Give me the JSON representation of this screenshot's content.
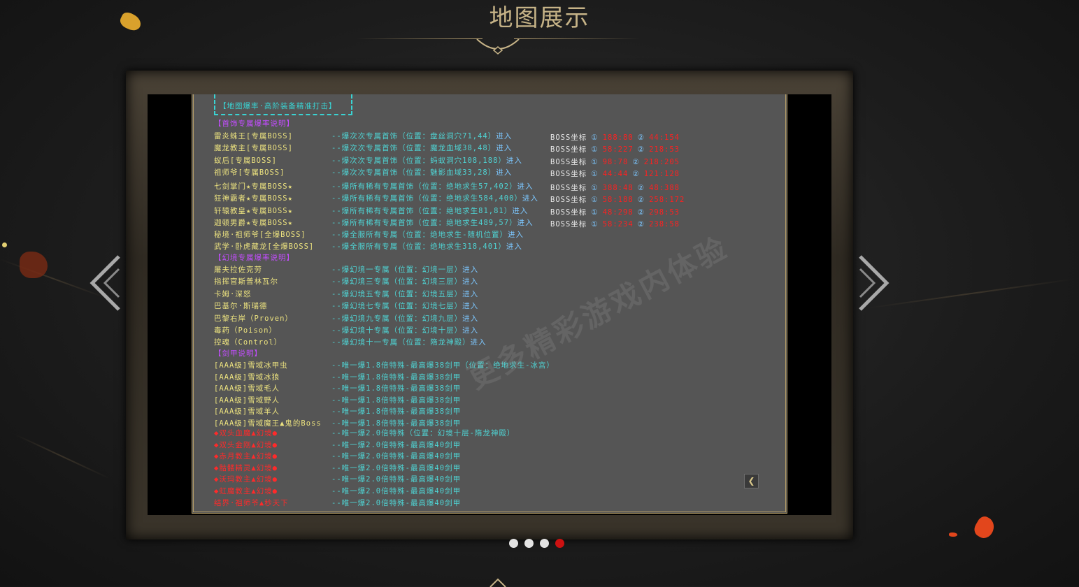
{
  "page": {
    "title": "地图展示",
    "watermark": "更多精彩游戏内体验"
  },
  "colors": {
    "title": "#c6b387",
    "gold_item": "#ece27f",
    "red_item": "#ff2a2a",
    "purple_header": "#c34dff",
    "cyan_desc": "#4fd3d3",
    "link_blue": "#7cc7ff",
    "active_dot": "#cc1111",
    "panel_bg": "#555555"
  },
  "icons": {
    "prev": "chevron-left-icon",
    "next": "chevron-right-icon",
    "back": "back-arrow-icon"
  },
  "slider": {
    "dots": 4,
    "active_index": 3
  },
  "slide": {
    "box_title": "【地图爆率·高阶装备精准打击】",
    "sections": [
      {
        "header": "【首饰专属爆率说明】"
      },
      {
        "header": "【幻境专属爆率说明】"
      },
      {
        "header": "【剑甲说明】"
      }
    ],
    "jewelry": [
      {
        "name": "雷炎蛛王[专属BOSS]",
        "desc": "--爆次次专属首饰（位置：盘丝洞穴71,44）",
        "link": "进入",
        "boss": "BOSS坐标",
        "c1": "①",
        "v1": "188:80",
        "c2": "②",
        "v2": "44:154"
      },
      {
        "name": "魔龙教主[专属BOSS]",
        "desc": "--爆次次专属首饰（位置：魔龙血域38,48）",
        "link": "进入",
        "boss": "BOSS坐标",
        "c1": "①",
        "v1": "58:227",
        "c2": "②",
        "v2": "218:53"
      },
      {
        "name": "蚁后[专属BOSS]",
        "desc": "--爆次次专属首饰（位置：蚂蚁洞穴108,188）",
        "link": "进入",
        "boss": "BOSS坐标",
        "c1": "①",
        "v1": "98:78",
        "c2": "②",
        "v2": "218:205"
      },
      {
        "name": "祖师爷[专属BOSS]",
        "desc": "--爆次次专属首饰（位置：魅影血域33,28）",
        "link": "进入",
        "boss": "BOSS坐标",
        "c1": "①",
        "v1": "44:44",
        "c2": "②",
        "v2": "121:128"
      },
      {
        "name": "七剑掌门★专属BOSS★",
        "desc": "--爆所有稀有专属首饰（位置：绝地求生57,402）",
        "link": "进入",
        "boss": "BOSS坐标",
        "c1": "①",
        "v1": "388:48",
        "c2": "②",
        "v2": "48:388"
      },
      {
        "name": "狂神霸者★专属BOSS★",
        "desc": "--爆所有稀有专属首饰（位置：绝地求生584,400）",
        "link": "进入",
        "boss": "BOSS坐标",
        "c1": "①",
        "v1": "58:188",
        "c2": "②",
        "v2": "258:172"
      },
      {
        "name": "轩辕教皇★专属BOSS★",
        "desc": "--爆所有稀有专属首饰（位置：绝地求生81,81）",
        "link": "进入",
        "boss": "BOSS坐标",
        "c1": "①",
        "v1": "48:298",
        "c2": "②",
        "v2": "298:53"
      },
      {
        "name": "迦顿男爵★专属BOSS★",
        "desc": "--爆所有稀有专属首饰（位置：绝地求生489,57）",
        "link": "进入",
        "boss": "BOSS坐标",
        "c1": "①",
        "v1": "58:234",
        "c2": "②",
        "v2": "238:58"
      },
      {
        "name": "秘境·祖师爷[全爆BOSS]",
        "desc": "--爆全服所有专属（位置：绝地求生-随机位置）",
        "link": "进入"
      },
      {
        "name": "武学·卧虎藏龙[全爆BOSS]",
        "desc": "--爆全服所有专属（位置：绝地求生318,401）",
        "link": "进入"
      }
    ],
    "illusion": [
      {
        "name": "屠夫拉佐克劳",
        "desc": "--爆幻境一专属（位置：幻境一层）",
        "link": "进入"
      },
      {
        "name": "指挥官斯普林瓦尔",
        "desc": "--爆幻境三专属（位置：幻境三层）",
        "link": "进入"
      },
      {
        "name": "卡姆·深怒",
        "desc": "--爆幻境五专属（位置：幻境五层）",
        "link": "进入"
      },
      {
        "name": "巴基尔·斯瑞德",
        "desc": "--爆幻境七专属（位置：幻境七层）",
        "link": "进入"
      },
      {
        "name": "巴黎右岸（Proven）",
        "desc": "--爆幻境九专属（位置：幻境九层）",
        "link": "进入"
      },
      {
        "name": "毒药（Poison）",
        "desc": "--爆幻境十专属（位置：幻境十层）",
        "link": "进入"
      },
      {
        "name": "控魂（Control）",
        "desc": "--爆幻境十一专属（位置：隋龙神殿）",
        "link": "进入"
      }
    ],
    "armor": [
      {
        "name": "[AAA级]雪域冰甲虫",
        "desc": "--唯一爆1.8倍特殊-最高爆38剑甲（位置：绝地求生-冰宫）",
        "red": false
      },
      {
        "name": "[AAA级]雪域冰狼",
        "desc": "--唯一爆1.8倍特殊-最高爆38剑甲",
        "red": false
      },
      {
        "name": "[AAA级]雪域毛人",
        "desc": "--唯一爆1.8倍特殊-最高爆38剑甲",
        "red": false
      },
      {
        "name": "[AAA级]雪域野人",
        "desc": "--唯一爆1.8倍特殊-最高爆38剑甲",
        "red": false
      },
      {
        "name": "[AAA级]雪域羊人",
        "desc": "--唯一爆1.8倍特殊-最高爆38剑甲",
        "red": false
      },
      {
        "name": "[AAA级]雪域魔王▲鬼的Boss",
        "desc": "--唯一爆1.8倍特殊-最高爆38剑甲",
        "red": false
      },
      {
        "name": "◆双头血魔▲幻境●",
        "desc": "--唯一爆2.0倍特殊（位置：幻境十层-隋龙神殿）",
        "red": true
      },
      {
        "name": "◆双头金刚▲幻境●",
        "desc": "--唯一爆2.0倍特殊-最高爆40剑甲",
        "red": true
      },
      {
        "name": "◆赤月教主▲幻境●",
        "desc": "--唯一爆2.0倍特殊-最高爆40剑甲",
        "red": true
      },
      {
        "name": "◆骷髅精灵▲幻境●",
        "desc": "--唯一爆2.0倍特殊-最高爆40剑甲",
        "red": true
      },
      {
        "name": "◆沃玛教主▲幻境●",
        "desc": "--唯一爆2.0倍特殊-最高爆40剑甲",
        "red": true
      },
      {
        "name": "◆虹魔教主▲幻境●",
        "desc": "--唯一爆2.0倍特殊-最高爆40剑甲",
        "red": true
      },
      {
        "name": "结界·祖师爷▲秒天下",
        "desc": "--唯一爆2.0倍特殊-最高爆40剑甲",
        "red": true
      }
    ]
  }
}
